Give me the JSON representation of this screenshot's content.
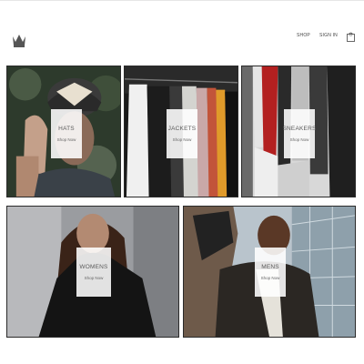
{
  "brand": {
    "logo_icon": "crown-icon"
  },
  "nav": {
    "shop": "SHOP",
    "sign_in": "SIGN IN",
    "cart_count": "0",
    "cart_icon": "shopping-bag-icon"
  },
  "categories": [
    {
      "title": "HATS",
      "cta": "Shop Now"
    },
    {
      "title": "JACKETS",
      "cta": "Shop Now"
    },
    {
      "title": "SNEAKERS",
      "cta": "Shop Now"
    },
    {
      "title": "WOMENS",
      "cta": "Shop Now"
    },
    {
      "title": "MENS",
      "cta": "Shop Now"
    }
  ]
}
